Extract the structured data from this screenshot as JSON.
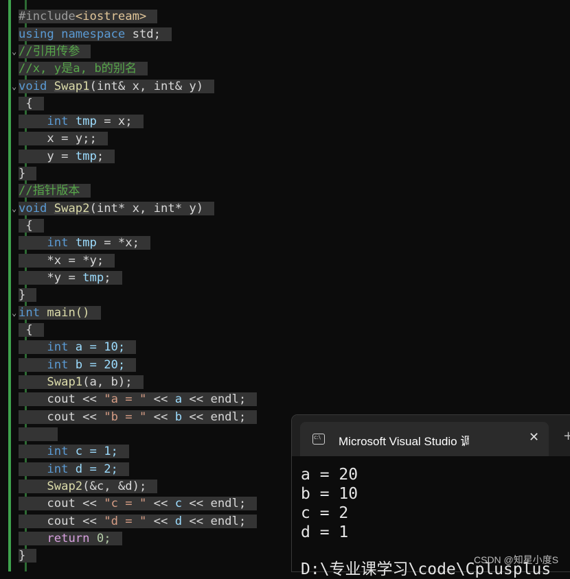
{
  "code": {
    "include_hash": "#include",
    "include_target": "<iostream>",
    "using": "using",
    "namespace": "namespace",
    "std": "std;",
    "comment_ref": "//引用传参",
    "comment_alias": "//x, y是a, b的别名",
    "void": "void",
    "swap1_name": "Swap1",
    "swap1_params": "(int& x, int& y)",
    "brace_open": "{",
    "brace_close": "}",
    "int": "int",
    "tmp": "tmp",
    "swap1_l1_rest": " = x;",
    "swap1_l2": "x = y;;",
    "swap1_l3_a": "y = ",
    "semi": ";",
    "comment_ptr": "//指针版本",
    "swap2_name": "Swap2",
    "swap2_params": "(int* x, int* y)",
    "swap2_l1_rest": " = *x;",
    "swap2_l2": "*x = *y;",
    "swap2_l3_a": "*y = ",
    "main_sig": "main()",
    "a_decl": " a = 10;",
    "b_decl": " b = 20;",
    "call_swap1": "Swap1",
    "call_swap1_args": "(a, b);",
    "cout": "cout",
    "op": " << ",
    "str_a": "\"a = \"",
    "str_b": "\"b = \"",
    "str_c": "\"c = \"",
    "str_d": "\"d = \"",
    "var_a": "a",
    "var_b": "b",
    "var_c": "c",
    "var_d": "d",
    "endl": "endl;",
    "c_decl": " c = 1;",
    "d_decl": " d = 2;",
    "call_swap2": "Swap2",
    "call_swap2_args": "(&c, &d);",
    "return_kw": "return",
    "return_val": " 0;"
  },
  "console": {
    "title": "Microsoft Visual Studio 调试控",
    "close": "✕",
    "new_tab": "+",
    "output": [
      "a = 20",
      "b = 10",
      "c = 2",
      "d = 1",
      "",
      "D:\\专业课学习\\code\\Cplusplus"
    ]
  },
  "watermark": "CSDN @知星小度S"
}
